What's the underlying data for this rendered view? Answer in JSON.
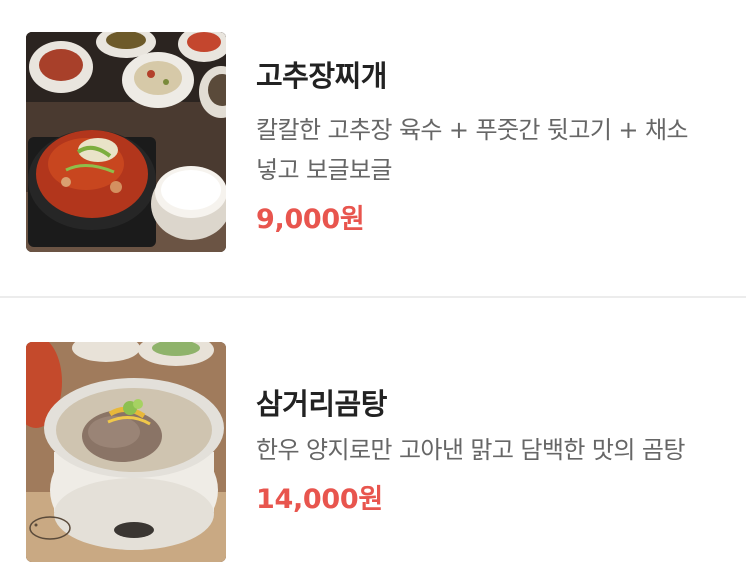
{
  "menu": {
    "items": [
      {
        "name": "고추장찌개",
        "description": "칼칼한 고추장 육수 + 푸줏간 뒷고기 + 채소\n넣고 보글보글",
        "price": "9,000원",
        "image": "gochujang-jjigae-photo"
      },
      {
        "name": "삼거리곰탕",
        "description": "한우 양지로만 고아낸 맑고 담백한 맛의 곰탕",
        "price": "14,000원",
        "image": "gomtang-photo"
      }
    ]
  },
  "colors": {
    "price": "#e8554e",
    "name": "#222222",
    "description": "#666666",
    "divider": "#ececec"
  }
}
